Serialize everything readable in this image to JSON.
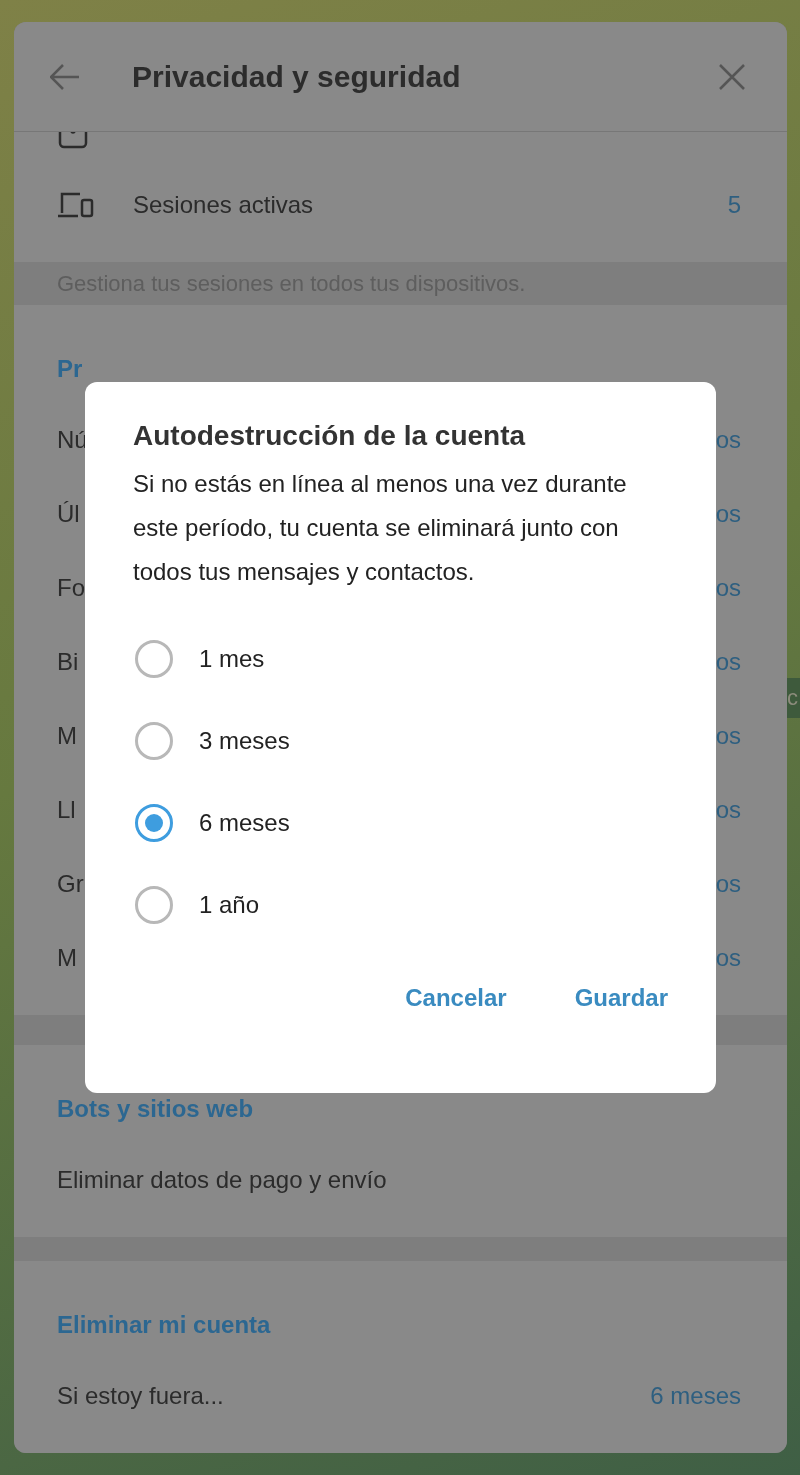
{
  "header": {
    "title": "Privacidad y seguridad"
  },
  "security_rows": [
    {
      "kind": "lock"
    },
    {
      "kind": "devices",
      "label": "Sesiones activas",
      "value": "5"
    }
  ],
  "security_note": "Gestiona tus sesiones en todos tus dispositivos.",
  "privacy": {
    "heading": "Pr",
    "rows": [
      {
        "label": "Nú",
        "value": "os"
      },
      {
        "label": "Úl",
        "value": "os"
      },
      {
        "label": "Fo",
        "value": "os"
      },
      {
        "label": "Bi",
        "value": "os"
      },
      {
        "label": "M",
        "value": "os"
      },
      {
        "label": "Ll",
        "value": "os"
      },
      {
        "label": "Gr",
        "value": "os"
      },
      {
        "label": "M",
        "value": "os"
      }
    ]
  },
  "bots": {
    "heading": "Bots y sitios web",
    "rows": [
      {
        "label": "Eliminar datos de pago y envío"
      }
    ]
  },
  "delete_account": {
    "heading": "Eliminar mi cuenta",
    "rows": [
      {
        "label": "Si estoy fuera...",
        "value": "6 meses"
      }
    ]
  },
  "background_fragment": "c",
  "dialog": {
    "title": "Autodestrucción de la cuenta",
    "text": "Si no estás en línea al menos una vez durante este período, tu cuenta se eliminará junto con todos tus mensajes y contactos.",
    "options": [
      {
        "label": "1 mes",
        "selected": false
      },
      {
        "label": "3 meses",
        "selected": false
      },
      {
        "label": "6 meses",
        "selected": true
      },
      {
        "label": "1 año",
        "selected": false
      }
    ],
    "buttons": [
      "Cancelar",
      "Guardar"
    ]
  }
}
